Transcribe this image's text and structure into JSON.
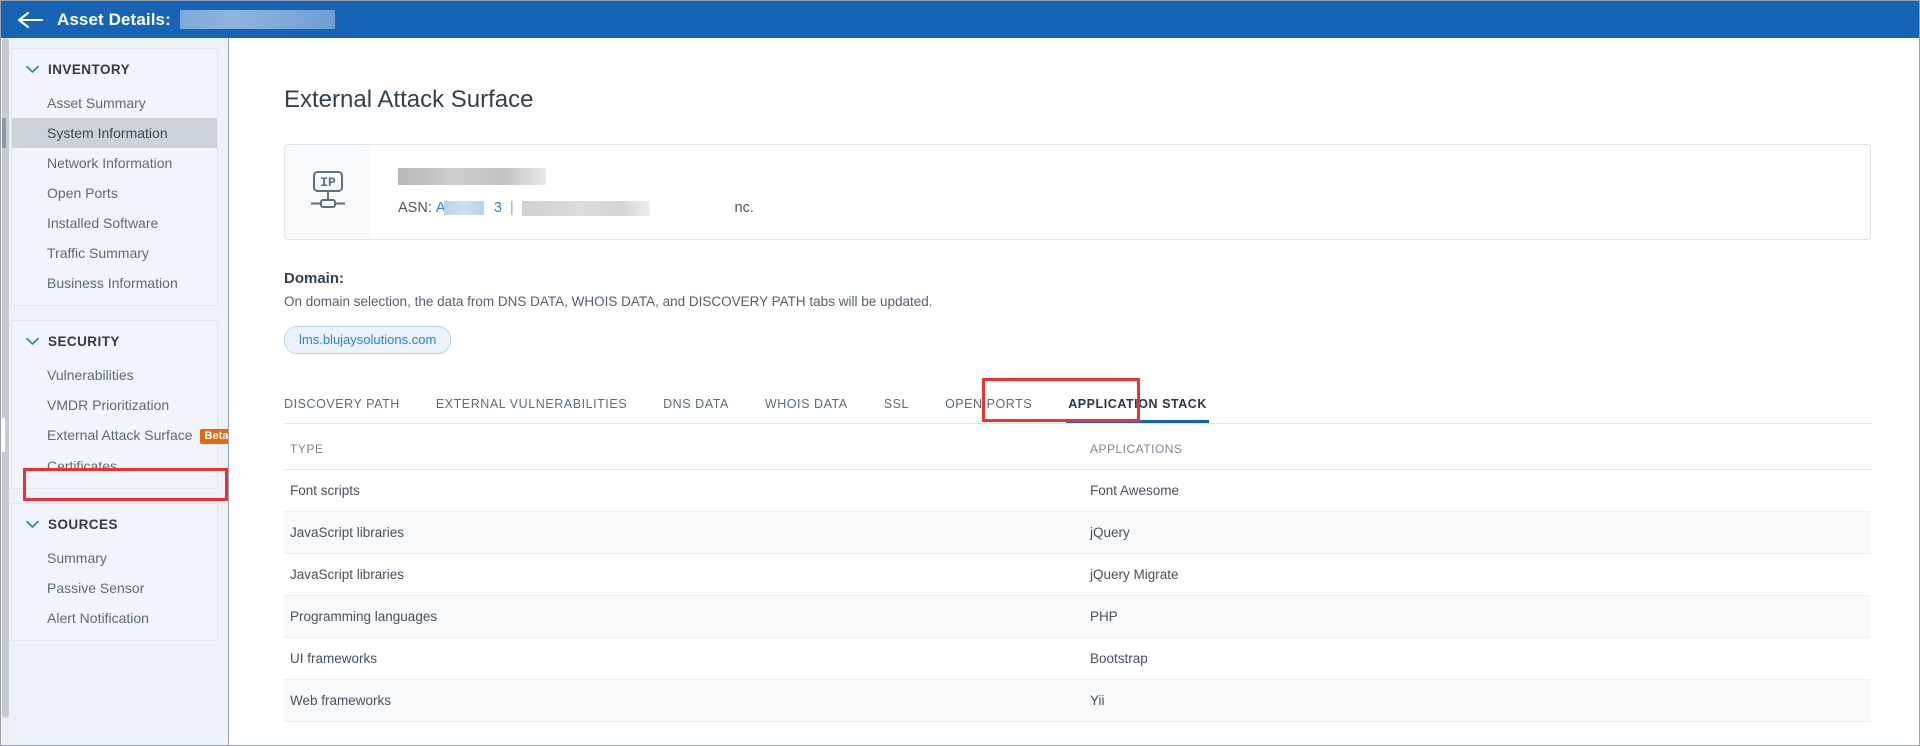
{
  "header": {
    "title": "Asset Details:",
    "back_icon": "arrow-left-icon",
    "redacted_asset_name": "",
    "bg_color": "#1763b5"
  },
  "sidebar": {
    "groups": [
      {
        "title": "INVENTORY",
        "chevron": "chevron-down-icon",
        "items": [
          {
            "label": "Asset Summary",
            "active": false
          },
          {
            "label": "System Information",
            "active": true
          },
          {
            "label": "Network Information",
            "active": false
          },
          {
            "label": "Open Ports",
            "active": false
          },
          {
            "label": "Installed Software",
            "active": false
          },
          {
            "label": "Traffic Summary",
            "active": false
          },
          {
            "label": "Business Information",
            "active": false
          }
        ]
      },
      {
        "title": "SECURITY",
        "chevron": "chevron-down-icon",
        "items": [
          {
            "label": "Vulnerabilities",
            "active": false
          },
          {
            "label": "VMDR Prioritization",
            "active": false
          },
          {
            "label": "External Attack Surface",
            "active": false,
            "badge": "Beta",
            "badge_color": "#e06a14",
            "highlighted": true
          },
          {
            "label": "Certificates",
            "active": false
          }
        ]
      },
      {
        "title": "SOURCES",
        "chevron": "chevron-down-icon",
        "items": [
          {
            "label": "Summary",
            "active": false
          },
          {
            "label": "Passive Sensor",
            "active": false
          },
          {
            "label": "Alert Notification",
            "active": false
          }
        ]
      }
    ]
  },
  "main": {
    "page_title": "External Attack Surface",
    "ip_card": {
      "icon": "ip-node-icon",
      "ip_redacted": "",
      "asn_label": "ASN:",
      "asn_prefix": "A",
      "asn_suffix": "3",
      "separator": "|",
      "org_suffix": "nc."
    },
    "domain": {
      "label": "Domain:",
      "description": "On domain selection, the data from DNS DATA, WHOIS DATA, and DISCOVERY PATH tabs will be updated.",
      "chip": "lms.blujaysolutions.com"
    },
    "tabs": [
      {
        "label": "DISCOVERY PATH",
        "active": false
      },
      {
        "label": "EXTERNAL VULNERABILITIES",
        "active": false
      },
      {
        "label": "DNS DATA",
        "active": false
      },
      {
        "label": "WHOIS DATA",
        "active": false
      },
      {
        "label": "SSL",
        "active": false
      },
      {
        "label": "OPEN PORTS",
        "active": false
      },
      {
        "label": "APPLICATION STACK",
        "active": true,
        "highlighted": true
      }
    ],
    "table": {
      "columns": [
        "TYPE",
        "APPLICATIONS"
      ],
      "rows": [
        {
          "type": "Font scripts",
          "application": "Font Awesome"
        },
        {
          "type": "JavaScript libraries",
          "application": "jQuery"
        },
        {
          "type": "JavaScript libraries",
          "application": "jQuery Migrate"
        },
        {
          "type": "Programming languages",
          "application": "PHP"
        },
        {
          "type": "UI frameworks",
          "application": "Bootstrap"
        },
        {
          "type": "Web frameworks",
          "application": "Yii"
        }
      ]
    }
  },
  "annotations": {
    "highlight_color": "#f03030",
    "accent_color": "#1763b5"
  }
}
